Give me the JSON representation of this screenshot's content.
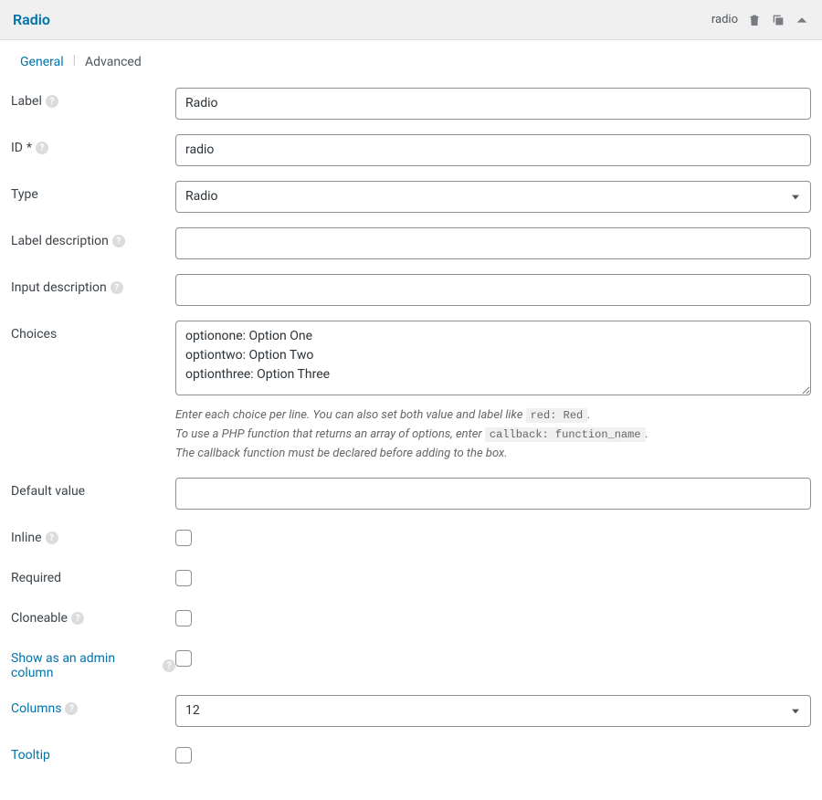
{
  "header": {
    "title": "Radio",
    "type_text": "radio"
  },
  "tabs": {
    "general": "General",
    "advanced": "Advanced"
  },
  "fields": {
    "label": {
      "label": "Label",
      "value": "Radio"
    },
    "id": {
      "label": "ID",
      "required": "*",
      "value": "radio"
    },
    "type": {
      "label": "Type",
      "value": "Radio",
      "options": [
        "Radio"
      ]
    },
    "label_description": {
      "label": "Label description",
      "value": ""
    },
    "input_description": {
      "label": "Input description",
      "value": ""
    },
    "choices": {
      "label": "Choices",
      "value": "optionone: Option One\noptiontwo: Option Two\noptionthree: Option Three",
      "hint_line1_a": "Enter each choice per line. You can also set both value and label like ",
      "hint_line1_code": "red: Red",
      "hint_line1_b": ".",
      "hint_line2_a": "To use a PHP function that returns an array of options, enter ",
      "hint_line2_code": "callback: function_name",
      "hint_line2_b": ".",
      "hint_line3": "The callback function must be declared before adding to the box."
    },
    "default_value": {
      "label": "Default value",
      "value": ""
    },
    "inline": {
      "label": "Inline",
      "checked": false
    },
    "required": {
      "label": "Required",
      "checked": false
    },
    "cloneable": {
      "label": "Cloneable",
      "checked": false
    },
    "admin_column": {
      "label": "Show as an admin column",
      "checked": false
    },
    "columns": {
      "label": "Columns",
      "value": "12",
      "options": [
        "12"
      ]
    },
    "tooltip": {
      "label": "Tooltip",
      "checked": false
    }
  }
}
